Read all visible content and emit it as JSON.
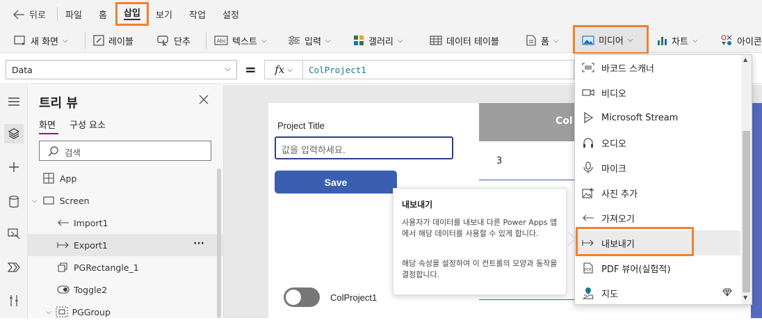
{
  "menu": {
    "back": "뒤로",
    "items": [
      "파일",
      "홈",
      "삽입",
      "보기",
      "작업",
      "설정"
    ]
  },
  "toolbar": {
    "new_screen": "새 화면",
    "label": "레이블",
    "button": "단추",
    "text": "텍스트",
    "input": "입력",
    "gallery": "갤러리",
    "data_table": "데이터 테이블",
    "form": "폼",
    "media": "미디어",
    "chart": "차트",
    "icons": "아이콘"
  },
  "formula": {
    "property": "Data",
    "equals": "=",
    "fx": "fx",
    "expression": "ColProject1"
  },
  "tree": {
    "title": "트리 뷰",
    "tab_screens": "화면",
    "tab_components": "구성 요소",
    "search_placeholder": "검색",
    "items": [
      {
        "label": "App"
      },
      {
        "label": "Screen"
      },
      {
        "label": "Import1"
      },
      {
        "label": "Export1"
      },
      {
        "label": "PGRectangle_1"
      },
      {
        "label": "Toggle2"
      },
      {
        "label": "PGGroup"
      }
    ],
    "more": "···"
  },
  "canvas": {
    "project_title_label": "Project Title",
    "input_placeholder": "값을 입력하세요.",
    "save_label": "Save",
    "table_header": "Col",
    "cell_value": "3",
    "toggle_label": "ColProject1"
  },
  "tooltip": {
    "title": "내보내기",
    "para1": "사용자가 데이터를 내보내 다른 Power Apps 앱에서 해당 데이터를 사용할 수 있게 합니다.",
    "para2": "해당 속성을 설정하여 이 컨트롤의 모양과 동작을 결정합니다."
  },
  "dropdown": {
    "items": [
      {
        "label": "바코드 스캐너",
        "icon": "barcode-icon"
      },
      {
        "label": "비디오",
        "icon": "video-icon"
      },
      {
        "label": "Microsoft Stream",
        "icon": "stream-icon"
      },
      {
        "label": "오디오",
        "icon": "headphones-icon"
      },
      {
        "label": "마이크",
        "icon": "microphone-icon"
      },
      {
        "label": "사진 추가",
        "icon": "add-picture-icon"
      },
      {
        "label": "가져오기",
        "icon": "import-icon"
      },
      {
        "label": "내보내기",
        "icon": "export-icon"
      },
      {
        "label": "PDF 뷰어(실험적)",
        "icon": "pdf-icon"
      },
      {
        "label": "지도",
        "icon": "map-icon"
      }
    ]
  },
  "colors": {
    "accent_orange": "#f08030",
    "save_blue": "#3a5fb0",
    "teal_text": "#1a7a8a",
    "selection_bar": "#742774"
  }
}
